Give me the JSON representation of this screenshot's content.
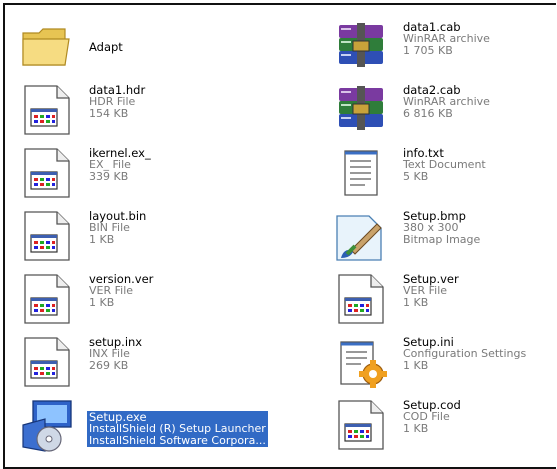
{
  "files": {
    "adapt": {
      "name": "Adapt"
    },
    "data1_hdr": {
      "name": "data1.hdr",
      "type": "HDR File",
      "size": "154 KB"
    },
    "ikernel": {
      "name": "ikernel.ex_",
      "type": "EX_ File",
      "size": "339 KB"
    },
    "layout": {
      "name": "layout.bin",
      "type": "BIN File",
      "size": "1 KB"
    },
    "version": {
      "name": "version.ver",
      "type": "VER File",
      "size": "1 KB"
    },
    "setup_inx": {
      "name": "setup.inx",
      "type": "INX File",
      "size": "269 KB"
    },
    "setup_exe": {
      "name": "Setup.exe",
      "type": "InstallShield (R) Setup Launcher",
      "size": "InstallShield Software Corpora..."
    },
    "data1_cab": {
      "name": "data1.cab",
      "type": "WinRAR archive",
      "size": "1 705 KB"
    },
    "data2_cab": {
      "name": "data2.cab",
      "type": "WinRAR archive",
      "size": "6 816 KB"
    },
    "info": {
      "name": "info.txt",
      "type": "Text Document",
      "size": "5 KB"
    },
    "setup_bmp": {
      "name": "Setup.bmp",
      "type": "380 x 300",
      "size": "Bitmap Image"
    },
    "setup_ver": {
      "name": "Setup.ver",
      "type": "VER File",
      "size": "1 KB"
    },
    "setup_ini": {
      "name": "Setup.ini",
      "type": "Configuration Settings",
      "size": "1 KB"
    },
    "setup_cod": {
      "name": "Setup.cod",
      "type": "COD File",
      "size": "1 KB"
    }
  },
  "selected": "setup_exe",
  "colors": {
    "selection": "#316ac5",
    "secondary_text": "#7a7a7a",
    "folder": "#f3d77a"
  },
  "icons": {
    "folder": "folder-icon",
    "generic": "generic-file-icon",
    "winrar": "winrar-archive-icon",
    "text": "text-document-icon",
    "bitmap": "bitmap-image-icon",
    "config": "configuration-settings-icon",
    "installer": "installshield-setup-icon"
  }
}
